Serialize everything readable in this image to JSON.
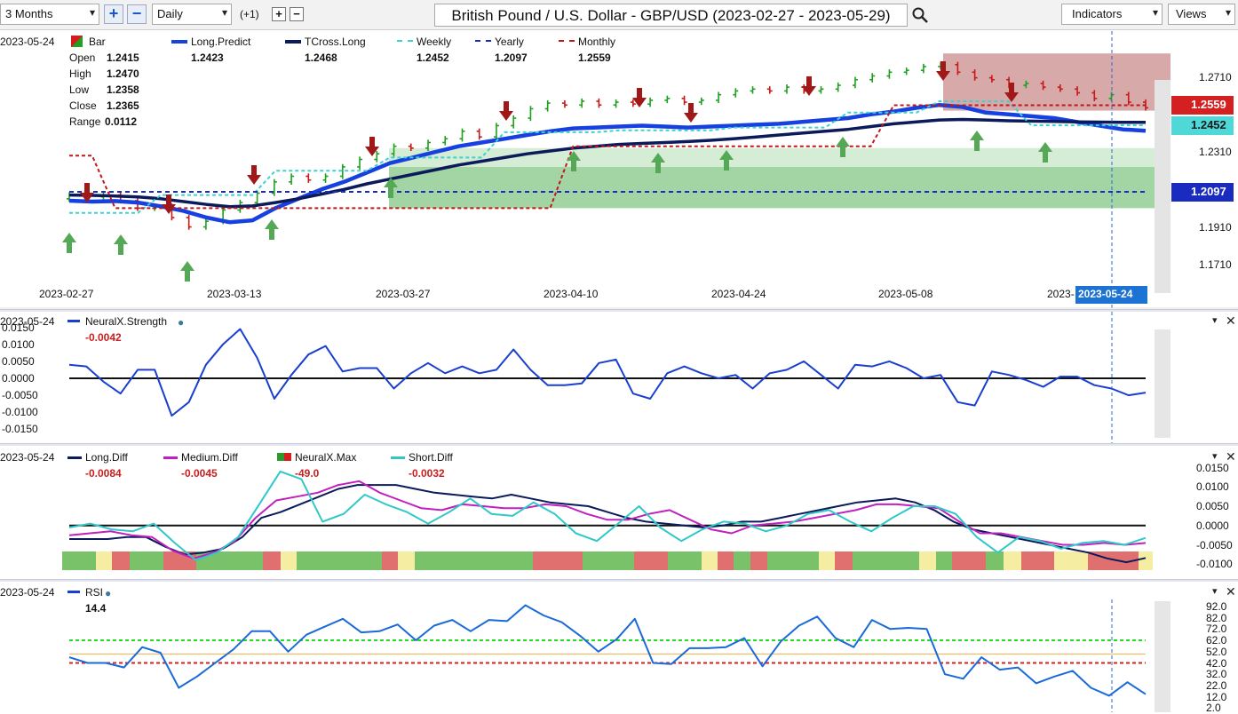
{
  "toolbar": {
    "range_select": "3 Months",
    "interval_select": "Daily",
    "offset": "(+1)",
    "title": "British Pound / U.S. Dollar - GBP/USD (2023-02-27 - 2023-05-29)",
    "indicators": "Indicators",
    "views": "Views"
  },
  "main": {
    "date": "2023-05-24",
    "bar_label": "Bar",
    "ohlc": [
      {
        "k": "Open",
        "v": "1.2415"
      },
      {
        "k": "High",
        "v": "1.2470"
      },
      {
        "k": "Low",
        "v": "1.2358"
      },
      {
        "k": "Close",
        "v": "1.2365"
      },
      {
        "k": "Range",
        "v": "0.0112"
      }
    ],
    "legend": [
      {
        "name": "Long.Predict",
        "value": "1.2423",
        "color": "#1640e0"
      },
      {
        "name": "TCross.Long",
        "value": "1.2468",
        "color": "#0a1a5a"
      },
      {
        "name": "Weekly",
        "value": "1.2452",
        "color": "#3fd0d0"
      },
      {
        "name": "Yearly",
        "value": "1.2097",
        "color": "#1a2cc0"
      },
      {
        "name": "Monthly",
        "value": "1.2559",
        "color": "#c01818"
      }
    ],
    "price_ticks": [
      "1.2710",
      "1.2310",
      "1.1910",
      "1.1710"
    ],
    "badges": [
      {
        "label": "1.2559",
        "bg": "#d42020"
      },
      {
        "label": "1.2452",
        "bg": "#4fd8d8"
      },
      {
        "label": "1.2097",
        "bg": "#1a2cc0"
      }
    ],
    "date_ticks": [
      "2023-02-27",
      "2023-03-13",
      "2023-03-27",
      "2023-04-10",
      "2023-04-24",
      "2023-05-08",
      "2023-"
    ],
    "cursor_date": "2023-05-24"
  },
  "strength": {
    "date": "2023-05-24",
    "name": "NeuralX.Strength",
    "value": "-0.0042",
    "ticks": [
      "0.0150",
      "0.0100",
      "0.0050",
      "0.0000",
      "-0.0050",
      "-0.0100",
      "-0.0150"
    ]
  },
  "diff": {
    "date": "2023-05-24",
    "legend": [
      {
        "name": "Long.Diff",
        "value": "-0.0084",
        "color": "#0a1a5a"
      },
      {
        "name": "Medium.Diff",
        "value": "-0.0045",
        "color": "#c020c0"
      },
      {
        "name": "NeuralX.Max",
        "value": "-49.0",
        "color": "#2c9a2c"
      },
      {
        "name": "Short.Diff",
        "value": "-0.0032",
        "color": "#30c8c8"
      }
    ],
    "ticks": [
      "0.0150",
      "0.0100",
      "0.0050",
      "0.0000",
      "-0.0050",
      "-0.0100"
    ]
  },
  "rsi": {
    "date": "2023-05-24",
    "name": "RSI",
    "value": "14.4",
    "ticks": [
      "92.0",
      "82.0",
      "72.0",
      "62.0",
      "52.0",
      "42.0",
      "32.0",
      "22.0",
      "12.0",
      "2.0"
    ]
  },
  "chart_data": [
    {
      "type": "line",
      "title": "British Pound / U.S. Dollar - GBP/USD (2023-02-27 - 2023-05-29)",
      "x_ticks": [
        "2023-02-27",
        "2023-03-13",
        "2023-03-27",
        "2023-04-10",
        "2023-04-24",
        "2023-05-08",
        "2023-05-22"
      ],
      "ylim": [
        1.16,
        1.285
      ],
      "series": [
        {
          "name": "Long.Predict",
          "values": [
            1.205,
            1.2045,
            1.2048,
            1.204,
            1.202,
            1.1995,
            1.196,
            1.1935,
            1.1945,
            1.201,
            1.206,
            1.211,
            1.215,
            1.22,
            1.225,
            1.228,
            1.231,
            1.234,
            1.236,
            1.238,
            1.24,
            1.242,
            1.2435,
            1.244,
            1.2445,
            1.245,
            1.2445,
            1.244,
            1.2445,
            1.245,
            1.2455,
            1.246,
            1.247,
            1.248,
            1.249,
            1.251,
            1.2525,
            1.2545,
            1.256,
            1.255,
            1.252,
            1.251,
            1.25,
            1.249,
            1.247,
            1.245,
            1.243,
            1.2423
          ]
        },
        {
          "name": "TCross.Long",
          "values": [
            1.208,
            1.2078,
            1.2075,
            1.207,
            1.206,
            1.2045,
            1.203,
            1.2018,
            1.2022,
            1.204,
            1.206,
            1.2085,
            1.211,
            1.214,
            1.2165,
            1.219,
            1.2215,
            1.224,
            1.226,
            1.228,
            1.23,
            1.2315,
            1.233,
            1.234,
            1.235,
            1.2355,
            1.236,
            1.2365,
            1.2372,
            1.238,
            1.239,
            1.24,
            1.241,
            1.242,
            1.243,
            1.2445,
            1.246,
            1.247,
            1.248,
            1.2483,
            1.248,
            1.2476,
            1.2474,
            1.2472,
            1.247,
            1.2469,
            1.2468,
            1.2468
          ]
        },
        {
          "name": "Weekly",
          "values": [
            1.1985,
            1.1985,
            1.1985,
            1.1985,
            1.208,
            1.208,
            1.208,
            1.208,
            1.208,
            1.221,
            1.221,
            1.221,
            1.221,
            1.221,
            1.228,
            1.228,
            1.228,
            1.228,
            1.228,
            1.2415,
            1.2415,
            1.2415,
            1.2415,
            1.2415,
            1.2425,
            1.2425,
            1.2425,
            1.2425,
            1.2425,
            1.244,
            1.244,
            1.244,
            1.244,
            1.244,
            1.252,
            1.252,
            1.252,
            1.252,
            1.258,
            1.258,
            1.258,
            1.258,
            1.2452,
            1.2452,
            1.2452,
            1.2452,
            1.2452,
            1.2452
          ]
        },
        {
          "name": "Yearly",
          "values": [
            1.2097,
            1.2097,
            1.2097,
            1.2097,
            1.2097,
            1.2097,
            1.2097,
            1.2097,
            1.2097,
            1.2097,
            1.2097,
            1.2097,
            1.2097,
            1.2097,
            1.2097,
            1.2097,
            1.2097,
            1.2097,
            1.2097,
            1.2097,
            1.2097,
            1.2097,
            1.2097,
            1.2097,
            1.2097,
            1.2097,
            1.2097,
            1.2097,
            1.2097,
            1.2097,
            1.2097,
            1.2097,
            1.2097,
            1.2097,
            1.2097,
            1.2097,
            1.2097,
            1.2097,
            1.2097,
            1.2097,
            1.2097,
            1.2097,
            1.2097,
            1.2097,
            1.2097,
            1.2097,
            1.2097,
            1.2097
          ]
        },
        {
          "name": "Monthly",
          "values": [
            1.229,
            1.229,
            1.201,
            1.201,
            1.201,
            1.201,
            1.201,
            1.201,
            1.201,
            1.201,
            1.201,
            1.201,
            1.201,
            1.201,
            1.201,
            1.201,
            1.201,
            1.201,
            1.201,
            1.201,
            1.201,
            1.201,
            1.234,
            1.234,
            1.234,
            1.234,
            1.234,
            1.234,
            1.234,
            1.234,
            1.234,
            1.234,
            1.234,
            1.234,
            1.234,
            1.234,
            1.2559,
            1.2559,
            1.2559,
            1.2559,
            1.2559,
            1.2559,
            1.2559,
            1.2559,
            1.2559,
            1.2559,
            1.2559,
            1.2559
          ]
        }
      ]
    },
    {
      "type": "line",
      "ylim": [
        -0.0175,
        0.0175
      ],
      "series": [
        {
          "name": "NeuralX.Strength",
          "values": [
            0.004,
            0.0035,
            -0.001,
            -0.0045,
            0.0025,
            0.0025,
            -0.011,
            -0.007,
            0.004,
            0.01,
            0.0145,
            0.006,
            -0.006,
            0.001,
            0.007,
            0.0095,
            0.002,
            0.003,
            0.003,
            -0.003,
            0.0015,
            0.0045,
            0.0015,
            0.0035,
            0.0015,
            0.0025,
            0.0085,
            0.0025,
            -0.002,
            -0.002,
            -0.0015,
            0.0045,
            0.0055,
            -0.0045,
            -0.006,
            0.0015,
            0.0035,
            0.0015,
            0.0,
            0.001,
            -0.003,
            0.0015,
            0.0025,
            0.005,
            0.001,
            -0.003,
            0.004,
            0.0035,
            0.005,
            0.003,
            0.0,
            0.001,
            -0.007,
            -0.008,
            0.002,
            0.001,
            -0.0005,
            -0.0025,
            0.0005,
            0.0005,
            -0.002,
            -0.003,
            -0.005,
            -0.0042
          ]
        }
      ]
    },
    {
      "type": "line",
      "ylim": [
        -0.012,
        0.0165
      ],
      "series": [
        {
          "name": "Long.Diff",
          "values": [
            -0.0035,
            -0.0035,
            -0.0035,
            -0.003,
            -0.003,
            -0.0055,
            -0.0075,
            -0.007,
            -0.006,
            -0.003,
            0.002,
            0.0035,
            0.0055,
            0.0075,
            0.0095,
            0.0105,
            0.0105,
            0.0105,
            0.0095,
            0.0085,
            0.008,
            0.0075,
            0.007,
            0.008,
            0.007,
            0.006,
            0.0055,
            0.005,
            0.0035,
            0.002,
            0.001,
            0.0005,
            0.0,
            -0.0005,
            0.0,
            0.001,
            0.001,
            0.002,
            0.003,
            0.004,
            0.005,
            0.006,
            0.0065,
            0.007,
            0.006,
            0.004,
            0.001,
            -0.001,
            -0.002,
            -0.003,
            -0.004,
            -0.005,
            -0.006,
            -0.007,
            -0.0085,
            -0.0095,
            -0.0084
          ]
        },
        {
          "name": "Medium.Diff",
          "values": [
            -0.0025,
            -0.002,
            -0.0015,
            -0.0025,
            -0.003,
            -0.0065,
            -0.0085,
            -0.007,
            -0.004,
            0.002,
            0.0065,
            0.0075,
            0.0085,
            0.0105,
            0.0115,
            0.0085,
            0.0065,
            0.0045,
            0.004,
            0.0055,
            0.005,
            0.0045,
            0.0045,
            0.0055,
            0.005,
            0.003,
            0.0015,
            0.0015,
            0.003,
            0.004,
            0.0015,
            -0.001,
            -0.002,
            0.0,
            0.0005,
            0.001,
            0.002,
            0.003,
            0.004,
            0.0055,
            0.0055,
            0.005,
            0.0045,
            0.001,
            -0.002,
            -0.002,
            -0.003,
            -0.004,
            -0.005,
            -0.005,
            -0.0045,
            -0.005,
            -0.0045
          ]
        },
        {
          "name": "Short.Diff",
          "values": [
            -0.0005,
            0.0005,
            -0.001,
            -0.0015,
            0.0005,
            -0.0045,
            -0.009,
            -0.007,
            -0.003,
            0.0055,
            0.014,
            0.012,
            0.001,
            0.003,
            0.008,
            0.0055,
            0.0035,
            0.0005,
            0.0035,
            0.007,
            0.003,
            0.0025,
            0.006,
            0.003,
            -0.002,
            -0.004,
            0.0005,
            0.005,
            -0.0005,
            -0.004,
            -0.001,
            0.001,
            0.0005,
            -0.0015,
            0.0,
            0.003,
            0.004,
            0.001,
            -0.0015,
            0.002,
            0.005,
            0.005,
            0.003,
            -0.003,
            -0.007,
            -0.003,
            -0.004,
            -0.006,
            -0.0045,
            -0.004,
            -0.005,
            -0.0032
          ]
        }
      ]
    },
    {
      "type": "line",
      "ylim": [
        0,
        95
      ],
      "series": [
        {
          "name": "RSI",
          "values": [
            47,
            42,
            42,
            38,
            56,
            51,
            20,
            30,
            42,
            54,
            70,
            70,
            52,
            67,
            74,
            81,
            69,
            70,
            76,
            62,
            75,
            80,
            70,
            80,
            79,
            93,
            84,
            78,
            66,
            52,
            63,
            81,
            42,
            41,
            55,
            55,
            56,
            64,
            39,
            61,
            75,
            83,
            64,
            56,
            80,
            72,
            73,
            72,
            32,
            28,
            47,
            36,
            38,
            24,
            30,
            35,
            20,
            13,
            25,
            14.4
          ]
        }
      ]
    }
  ]
}
